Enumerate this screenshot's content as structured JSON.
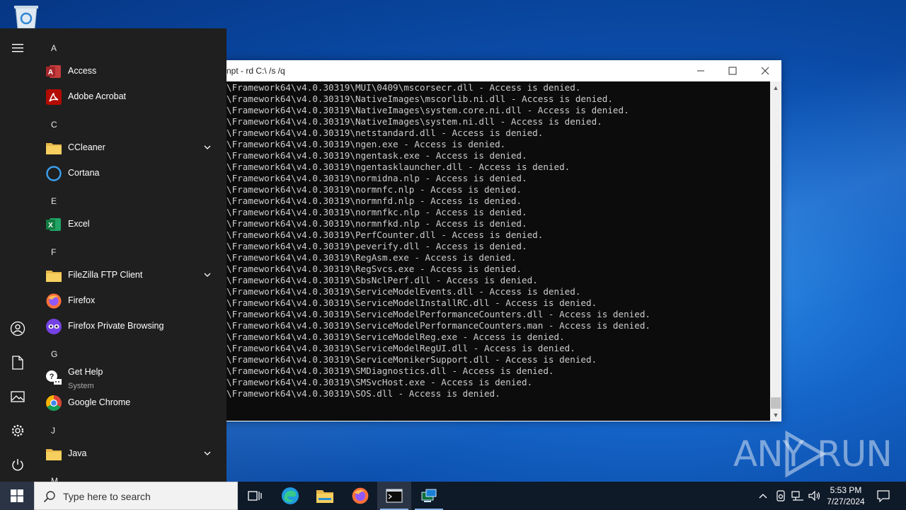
{
  "console": {
    "title": "npt - rd  C:\\ /s /q",
    "lines": [
      "\\Framework64\\v4.0.30319\\MUI\\0409\\mscorsecr.dll - Access is denied.",
      "\\Framework64\\v4.0.30319\\NativeImages\\mscorlib.ni.dll - Access is denied.",
      "\\Framework64\\v4.0.30319\\NativeImages\\system.core.ni.dll - Access is denied.",
      "\\Framework64\\v4.0.30319\\NativeImages\\system.ni.dll - Access is denied.",
      "\\Framework64\\v4.0.30319\\netstandard.dll - Access is denied.",
      "\\Framework64\\v4.0.30319\\ngen.exe - Access is denied.",
      "\\Framework64\\v4.0.30319\\ngentask.exe - Access is denied.",
      "\\Framework64\\v4.0.30319\\ngentasklauncher.dll - Access is denied.",
      "\\Framework64\\v4.0.30319\\normidna.nlp - Access is denied.",
      "\\Framework64\\v4.0.30319\\normnfc.nlp - Access is denied.",
      "\\Framework64\\v4.0.30319\\normnfd.nlp - Access is denied.",
      "\\Framework64\\v4.0.30319\\normnfkc.nlp - Access is denied.",
      "\\Framework64\\v4.0.30319\\normnfkd.nlp - Access is denied.",
      "\\Framework64\\v4.0.30319\\PerfCounter.dll - Access is denied.",
      "\\Framework64\\v4.0.30319\\peverify.dll - Access is denied.",
      "\\Framework64\\v4.0.30319\\RegAsm.exe - Access is denied.",
      "\\Framework64\\v4.0.30319\\RegSvcs.exe - Access is denied.",
      "\\Framework64\\v4.0.30319\\SbsNclPerf.dll - Access is denied.",
      "\\Framework64\\v4.0.30319\\ServiceModelEvents.dll - Access is denied.",
      "\\Framework64\\v4.0.30319\\ServiceModelInstallRC.dll - Access is denied.",
      "\\Framework64\\v4.0.30319\\ServiceModelPerformanceCounters.dll - Access is denied.",
      "\\Framework64\\v4.0.30319\\ServiceModelPerformanceCounters.man - Access is denied.",
      "\\Framework64\\v4.0.30319\\ServiceModelReg.exe - Access is denied.",
      "\\Framework64\\v4.0.30319\\ServiceModelRegUI.dll - Access is denied.",
      "\\Framework64\\v4.0.30319\\ServiceMonikerSupport.dll - Access is denied.",
      "\\Framework64\\v4.0.30319\\SMDiagnostics.dll - Access is denied.",
      "\\Framework64\\v4.0.30319\\SMSvcHost.exe - Access is denied.",
      "\\Framework64\\v4.0.30319\\SOS.dll - Access is denied."
    ]
  },
  "start_menu": {
    "letters": {
      "a": "A",
      "c": "C",
      "e": "E",
      "f": "F",
      "g": "G",
      "j": "J",
      "m": "M"
    },
    "apps": {
      "access": "Access",
      "acrobat": "Adobe Acrobat",
      "ccleaner": "CCleaner",
      "cortana": "Cortana",
      "excel": "Excel",
      "filezilla": "FileZilla FTP Client",
      "firefox": "Firefox",
      "firefox_private": "Firefox Private Browsing",
      "get_help": "Get Help",
      "get_help_sub": "System",
      "chrome": "Google Chrome",
      "java": "Java"
    }
  },
  "taskbar": {
    "search_placeholder": "Type here to search",
    "time": "5:53 PM",
    "date": "7/27/2024"
  },
  "watermark": {
    "left": "ANY",
    "right": "RUN"
  },
  "colors": {
    "desktop_accent": "#1565c9",
    "menu_bg": "#1f1f1f",
    "console_bg": "#0c0c0c",
    "console_text": "#cccccc",
    "taskbar_bg": "#0f1a29"
  }
}
